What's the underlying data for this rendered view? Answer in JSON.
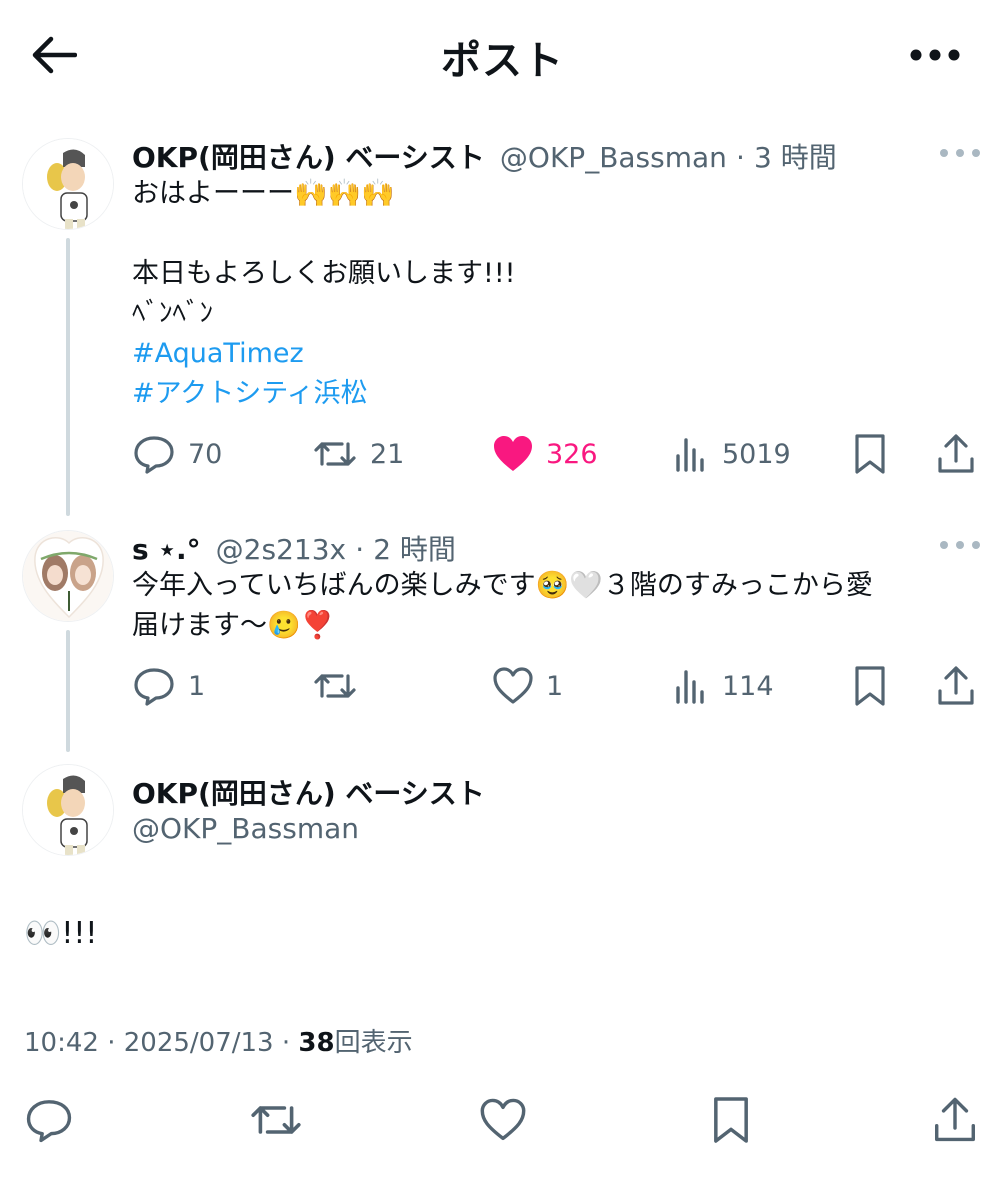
{
  "header": {
    "title": "ポスト"
  },
  "posts": [
    {
      "name": "OKP(岡田さん) ベーシスト",
      "handle": "@OKP_Bassman",
      "time_sep": "·",
      "time": "3 時間",
      "lines": [
        "おはよーーー🙌🙌🙌",
        "",
        "本日もよろしくお願いします!!!",
        "ﾍﾞﾝﾍﾞﾝ"
      ],
      "hashtags": [
        "#AquaTimez",
        "#アクトシティ浜松"
      ],
      "stats": {
        "replies": "70",
        "reposts": "21",
        "likes": "326",
        "views": "5019"
      }
    },
    {
      "name": "s ⋆.°",
      "handle": "@2s213x",
      "time_sep": "·",
      "time": "2 時間",
      "lines": [
        "今年入っていちばんの楽しみです🥹🤍３階のすみっこから愛",
        "届けます〜🥲❣️"
      ],
      "stats": {
        "replies": "1",
        "reposts": "",
        "likes": "1",
        "views": "114"
      }
    }
  ],
  "main_post": {
    "name": "OKP(岡田さん) ベーシスト",
    "handle": "@OKP_Bassman",
    "text": "👀!!!",
    "time": "10:42",
    "date": "2025/07/13",
    "sep": "·",
    "views_count": "38",
    "views_label": "回表示"
  },
  "colors": {
    "like_active": "#f91880",
    "hashtag": "#1d9bf0",
    "secondary_text": "#536471",
    "thread_line": "#cfd9de"
  },
  "icons": [
    "back-arrow-icon",
    "more-horizontal-icon",
    "reply-icon",
    "repost-icon",
    "like-icon",
    "views-icon",
    "bookmark-icon",
    "share-icon"
  ]
}
